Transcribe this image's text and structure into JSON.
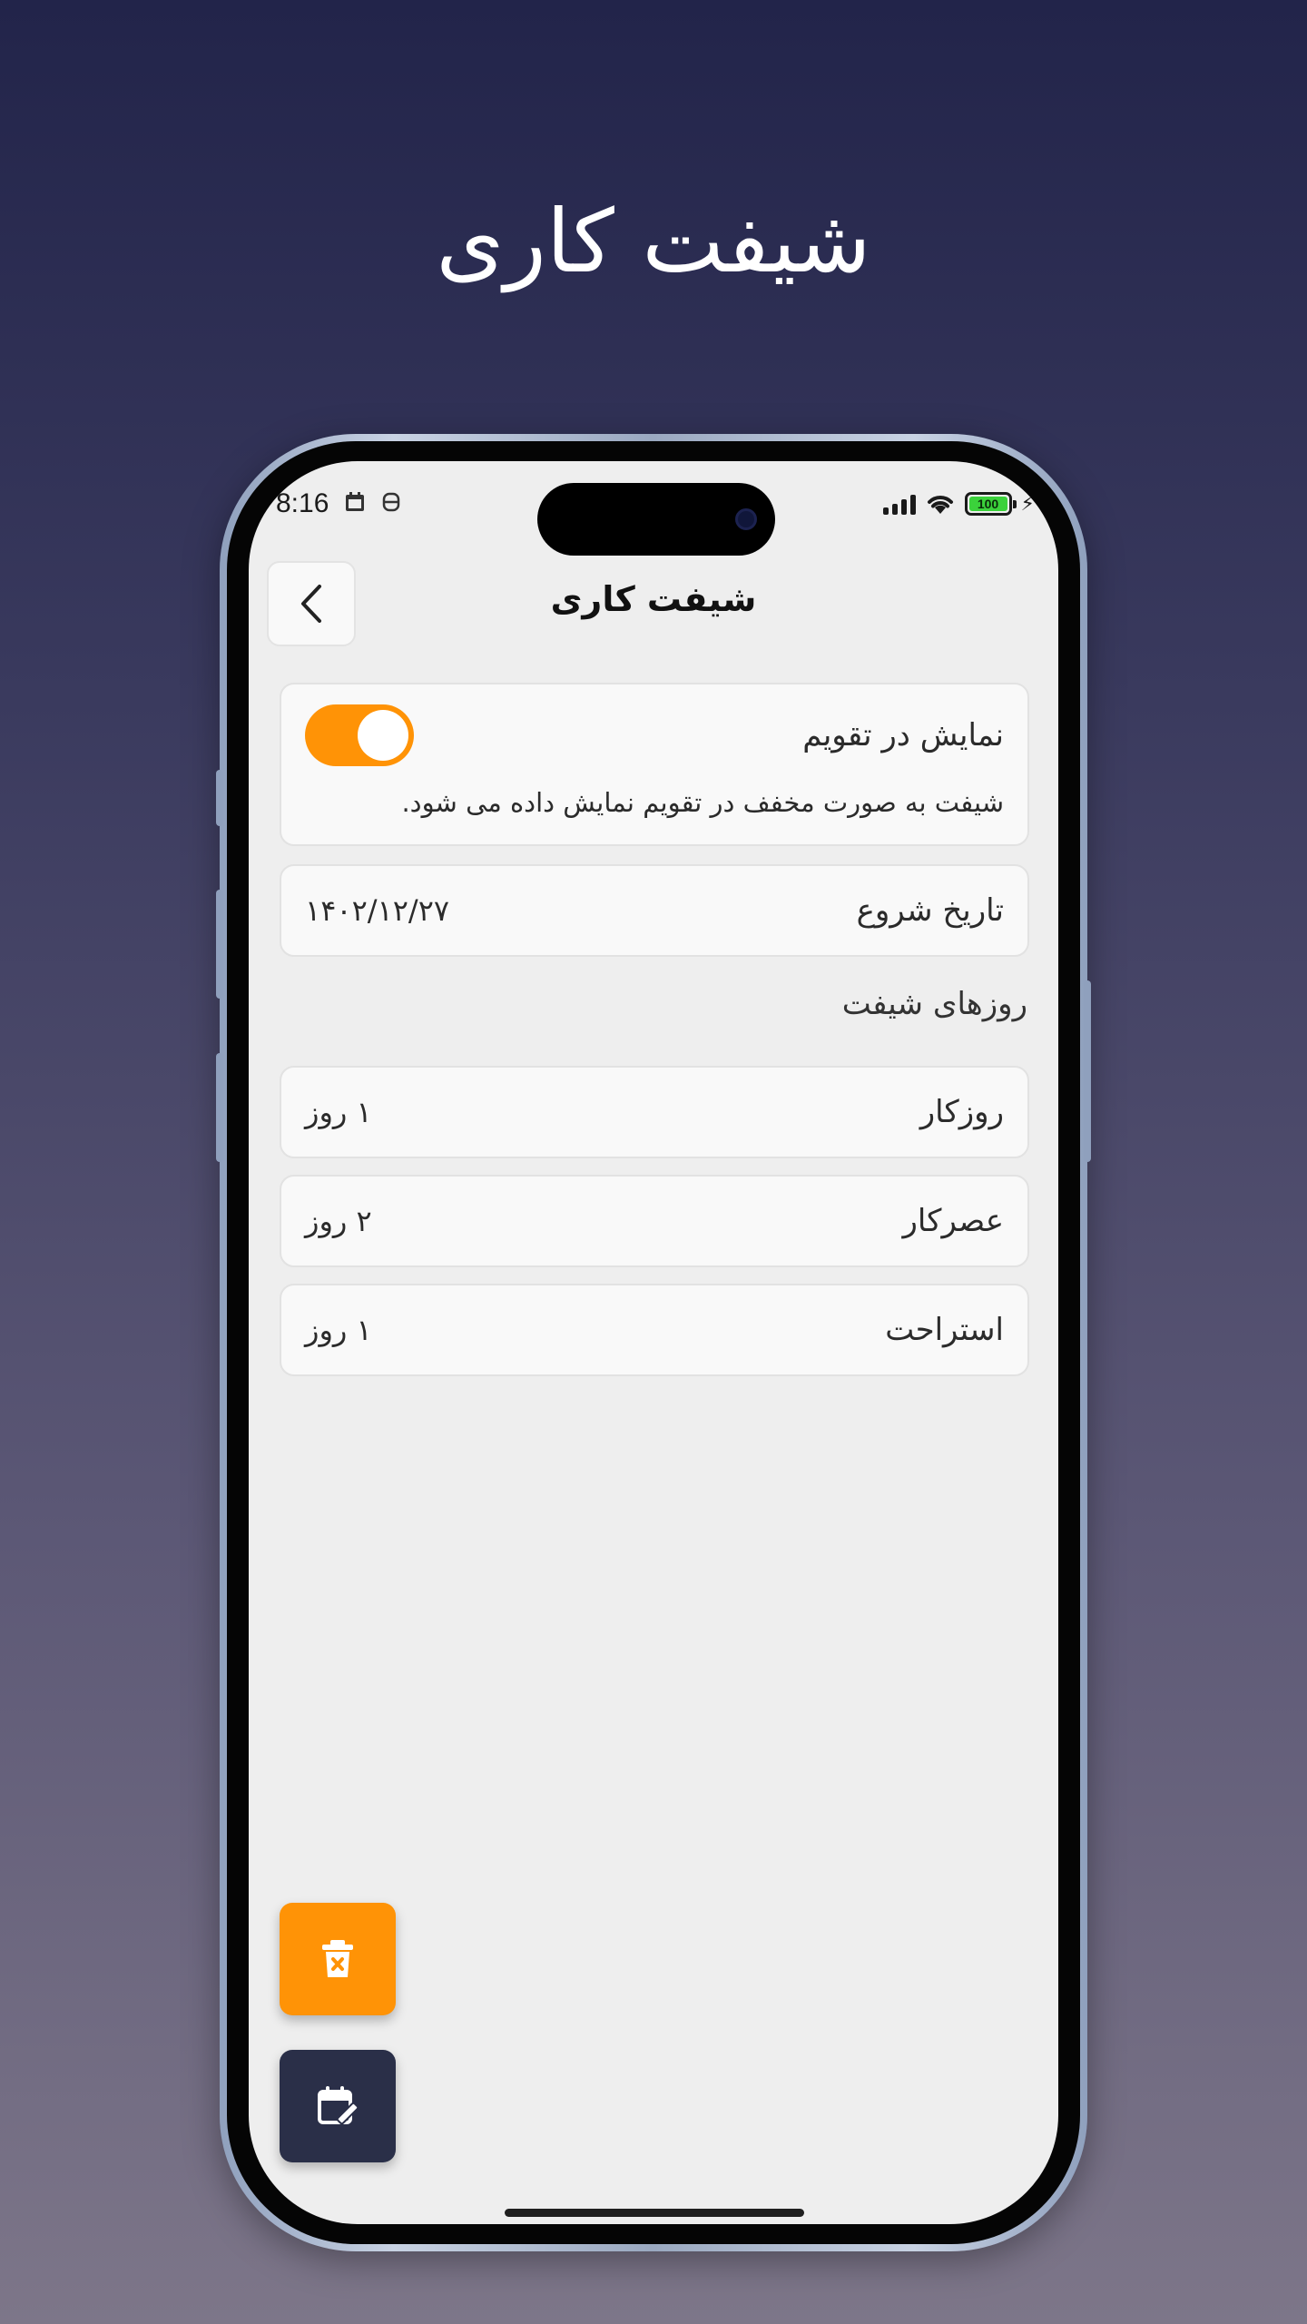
{
  "hero": {
    "title": "شیفت کاری"
  },
  "status_bar": {
    "time": "8:16",
    "battery": "100"
  },
  "header": {
    "title": "شیفت کاری"
  },
  "calendar_card": {
    "label": "نمایش در تقویم",
    "description": "شیفت به صورت مخفف در تقویم نمایش داده می شود.",
    "toggle_on": true,
    "toggle_color": "#ff9306"
  },
  "start_date": {
    "label": "تاریخ شروع",
    "value": "۱۴۰۲/۱۲/۲۷"
  },
  "shift_days": {
    "section_label": "روزهای شیفت",
    "items": [
      {
        "label": "روزکار",
        "value": "۱ روز"
      },
      {
        "label": "عصرکار",
        "value": "۲ روز"
      },
      {
        "label": "استراحت",
        "value": "۱ روز"
      }
    ]
  },
  "fabs": {
    "delete_icon": "delete-calendar-icon",
    "edit_icon": "edit-calendar-icon",
    "delete_color": "#ff9306",
    "edit_color": "#2a2f48"
  }
}
